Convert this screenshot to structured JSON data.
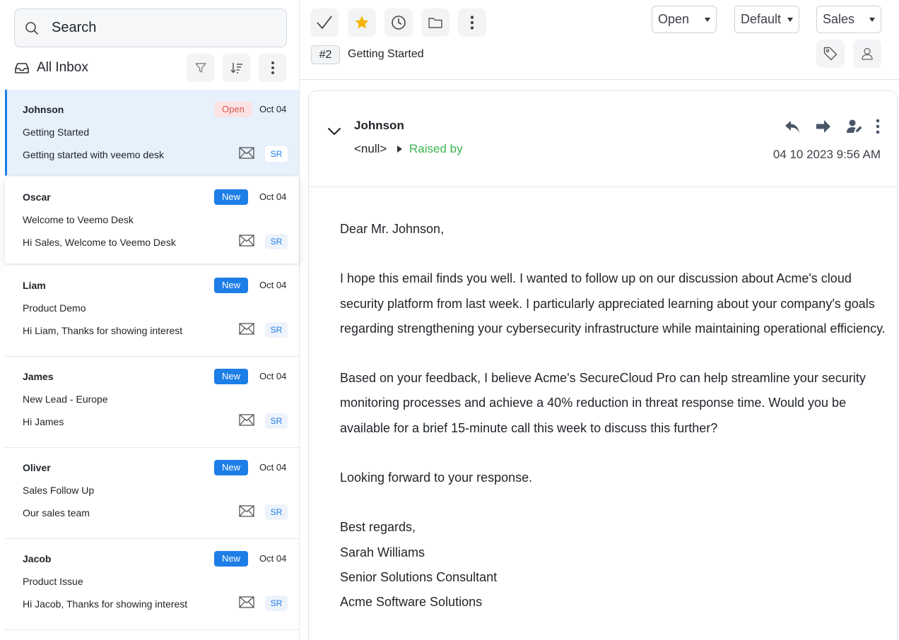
{
  "search": {
    "placeholder": "Search"
  },
  "inbox": {
    "title": "All Inbox"
  },
  "conversations": [
    {
      "name": "Johnson",
      "status": "Open",
      "date": "Oct 04",
      "subject": "Getting Started",
      "preview": "Getting started with veemo desk",
      "tag": "SR"
    },
    {
      "name": "Oscar",
      "status": "New",
      "date": "Oct 04",
      "subject": "Welcome to Veemo Desk",
      "preview": "Hi Sales, Welcome to Veemo Desk",
      "tag": "SR"
    },
    {
      "name": "Liam",
      "status": "New",
      "date": "Oct 04",
      "subject": "Product Demo",
      "preview": "Hi Liam, Thanks for showing interest",
      "tag": "SR"
    },
    {
      "name": "James",
      "status": "New",
      "date": "Oct 04",
      "subject": "New Lead - Europe",
      "preview": "Hi James",
      "tag": "SR"
    },
    {
      "name": "Oliver",
      "status": "New",
      "date": "Oct 04",
      "subject": "Sales Follow Up",
      "preview": "Our sales team",
      "tag": "SR"
    },
    {
      "name": "Jacob",
      "status": "New",
      "date": "Oct 04",
      "subject": "Product Issue",
      "preview": "Hi Jacob, Thanks for showing interest",
      "tag": "SR"
    }
  ],
  "toolbar": {
    "status_select": "Open",
    "priority_select": "Default",
    "team_select": "Sales"
  },
  "ticket": {
    "id": "#2",
    "title": "Getting Started"
  },
  "email": {
    "sender": "Johnson",
    "from": "<null>",
    "raised_by": "Raised by",
    "timestamp": "04 10 2023 9:56 AM",
    "greeting": "Dear Mr. Johnson,",
    "para1": "I hope this email finds you well. I wanted to follow up on our discussion about Acme's cloud security platform from last week. I particularly appreciated learning about your company's goals regarding strengthening your cybersecurity infrastructure while maintaining operational efficiency.",
    "para2": "Based on your feedback, I believe Acme's SecureCloud Pro can help streamline your security monitoring processes and achieve a 40% reduction in threat response time. Would you be available for a brief 15-minute call this week to discuss this further?",
    "para3": "Looking forward to your response.",
    "closing": "Best regards,",
    "sig_name": "Sarah Williams",
    "sig_title": "Senior Solutions Consultant",
    "sig_company": "Acme Software Solutions"
  },
  "colors": {
    "accent": "#1d7ee8",
    "open_badge": "#d9534f",
    "raised_by": "#3cb554",
    "star": "#f4b400"
  }
}
